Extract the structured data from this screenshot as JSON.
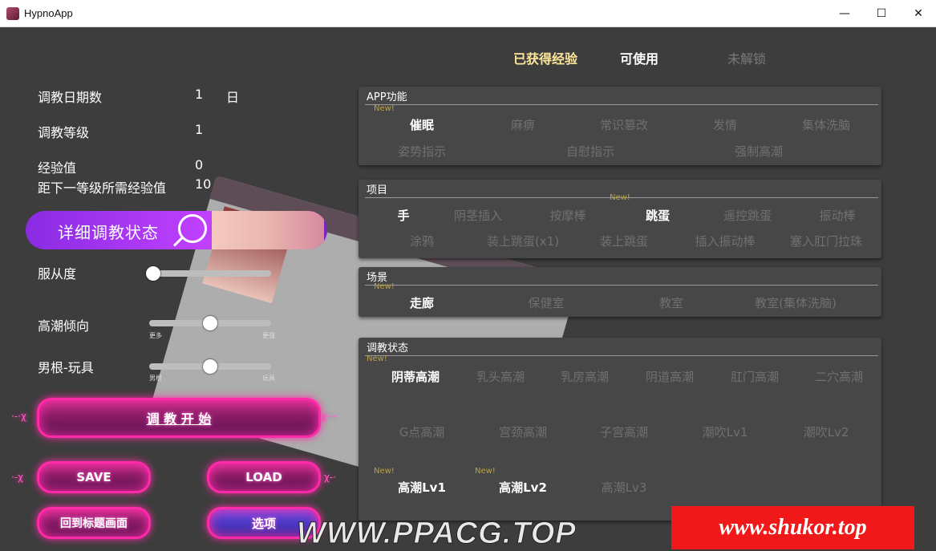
{
  "window": {
    "title": "HypnoApp",
    "min_glyph": "—",
    "max_glyph": "☐",
    "close_glyph": "✕"
  },
  "stats": [
    {
      "label": "调教日期数",
      "value": "1",
      "unit": "日"
    },
    {
      "label": "调教等级",
      "value": "1"
    },
    {
      "label": "经验值",
      "value": "0"
    },
    {
      "label": "距下一等级所需经验值",
      "value": "10"
    }
  ],
  "status_button": {
    "label": "详细调教状态"
  },
  "sliders": [
    {
      "label": "服从度",
      "level": 0.0,
      "min_caption": "",
      "max_caption": ""
    },
    {
      "label": "高潮倾向",
      "level": 0.5,
      "min_caption": "更多",
      "max_caption": "更强"
    },
    {
      "label": "男根-玩具",
      "level": 0.5,
      "min_caption": "男根",
      "max_caption": "玩具"
    }
  ],
  "buttons": {
    "start": "调 教 开 始",
    "save": "SAVE",
    "load": "LOAD",
    "title_screen": "回到标题画面",
    "options": "选项"
  },
  "tabs": [
    {
      "label": "已获得经验",
      "color": "#ffe79a"
    },
    {
      "label": "可使用",
      "color": "#ffffff"
    },
    {
      "label": "未解锁",
      "color": "#7a7a7a"
    }
  ],
  "new_tag": "New!",
  "panels": {
    "app": {
      "title": "APP功能",
      "row1": [
        {
          "label": "催眠",
          "on": true
        },
        {
          "label": "麻痹",
          "on": false
        },
        {
          "label": "常识篡改",
          "on": false
        },
        {
          "label": "发情",
          "on": false
        },
        {
          "label": "集体洗脑",
          "on": false
        }
      ],
      "row2": [
        {
          "label": "姿势指示",
          "on": false
        },
        {
          "label": "自慰指示",
          "on": false
        },
        {
          "label": "强制高潮",
          "on": false
        }
      ]
    },
    "items": {
      "title": "项目",
      "row1": [
        {
          "label": "手",
          "on": true
        },
        {
          "label": "阴茎插入",
          "on": false
        },
        {
          "label": "按摩棒",
          "on": false
        },
        {
          "label": "跳蛋",
          "on": true
        },
        {
          "label": "遥控跳蛋",
          "on": false
        },
        {
          "label": "振动棒",
          "on": false
        }
      ],
      "row2": [
        {
          "label": "涂鸦",
          "on": false
        },
        {
          "label": "装上跳蛋(x1)",
          "on": false
        },
        {
          "label": "装上跳蛋",
          "on": false
        },
        {
          "label": "插入振动棒",
          "on": false
        },
        {
          "label": "塞入肛门拉珠",
          "on": false
        }
      ]
    },
    "scene": {
      "title": "场景",
      "row1": [
        {
          "label": "走廊",
          "on": true
        },
        {
          "label": "保健室",
          "on": false
        },
        {
          "label": "教室",
          "on": false
        },
        {
          "label": "教室(集体洗脑)",
          "on": false
        }
      ]
    },
    "status": {
      "title": "调教状态",
      "row1": [
        {
          "label": "阴蒂高潮",
          "on": true
        },
        {
          "label": "乳头高潮",
          "on": false
        },
        {
          "label": "乳房高潮",
          "on": false
        },
        {
          "label": "阴道高潮",
          "on": false
        },
        {
          "label": "肛门高潮",
          "on": false
        },
        {
          "label": "二穴高潮",
          "on": false
        }
      ],
      "row2": [
        {
          "label": "G点高潮",
          "on": false
        },
        {
          "label": "宫颈高潮",
          "on": false
        },
        {
          "label": "子宫高潮",
          "on": false
        },
        {
          "label": "潮吹Lv1",
          "on": false
        },
        {
          "label": "潮吹Lv2",
          "on": false
        }
      ],
      "row3": [
        {
          "label": "高潮Lv1",
          "on": true
        },
        {
          "label": "高潮Lv2",
          "on": true
        },
        {
          "label": "高潮Lv3",
          "on": false
        }
      ]
    }
  },
  "watermarks": {
    "left": "WWW.PPACG.TOP",
    "right": "www.shukor.top"
  },
  "colors": {
    "accent_purple": "#a63af0",
    "neon_pink": "#ff2aa8",
    "watermark_red": "#f01818"
  }
}
